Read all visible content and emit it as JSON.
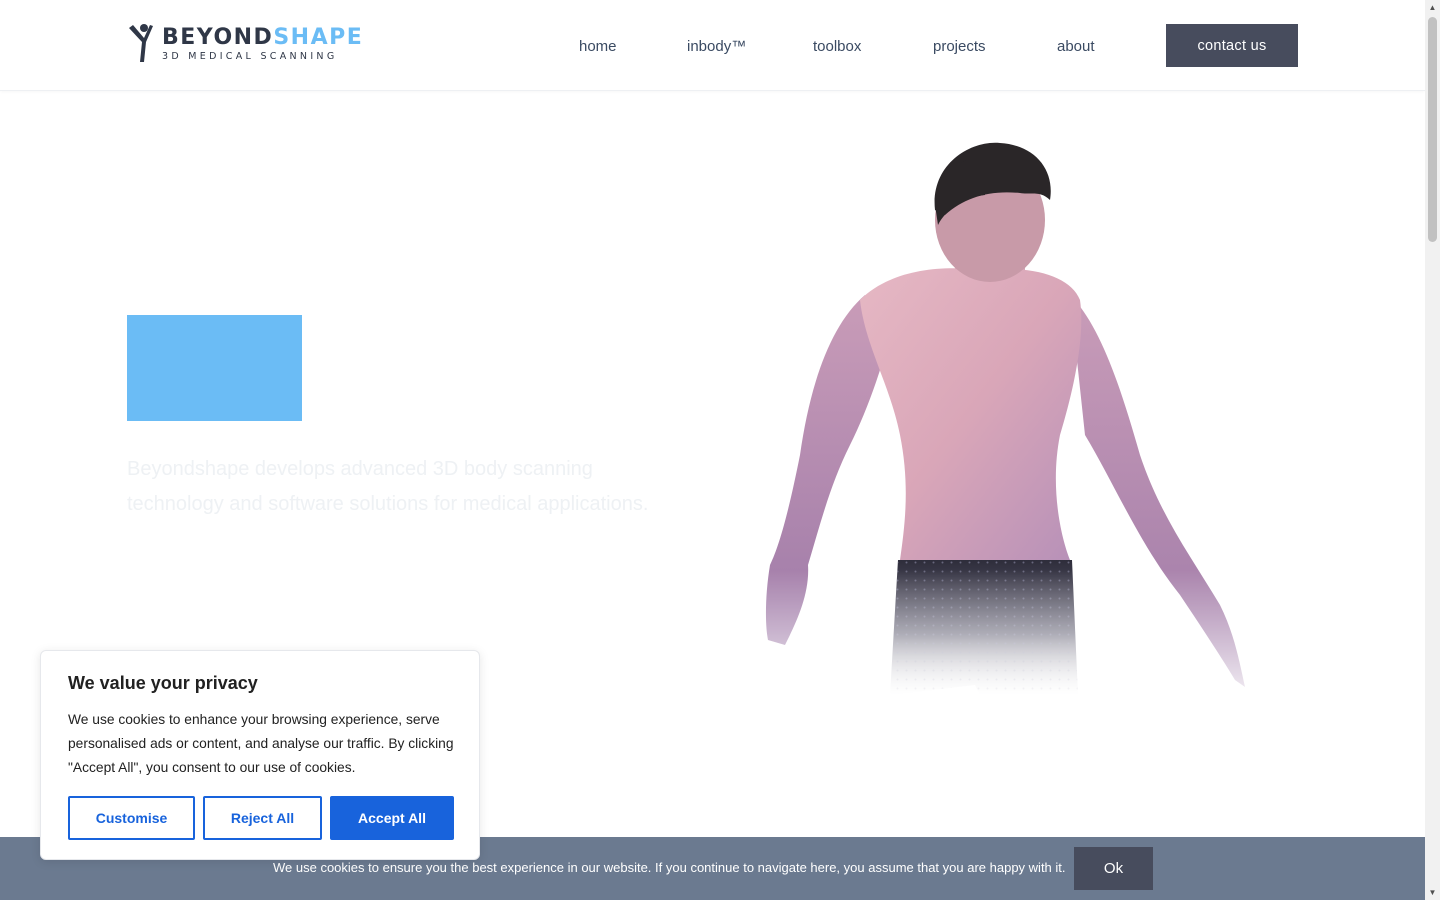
{
  "header": {
    "logo": {
      "word_part1": "BEYOND",
      "word_part2": "SHAPE",
      "subtitle": "3D MEDICAL SCANNING",
      "icon": "figure-logo-icon"
    },
    "nav": [
      {
        "label": "home"
      },
      {
        "label": "inbody™"
      },
      {
        "label": "toolbox"
      },
      {
        "label": "projects"
      },
      {
        "label": "about"
      }
    ],
    "contact_label": "contact us"
  },
  "hero": {
    "text": "Beyondshape develops advanced 3D body scanning technology and software solutions for medical applications.",
    "image": "3d-body-scan-back-view",
    "accent_color": "#6bbcf5"
  },
  "cookie_modal": {
    "title": "We value your privacy",
    "body": "We use cookies to enhance your browsing experience, serve personalised ads or content, and analyse our traffic. By clicking \"Accept All\", you consent to our use of cookies.",
    "buttons": {
      "customise": "Customise",
      "reject": "Reject All",
      "accept": "Accept All"
    },
    "button_color": "#1863dc"
  },
  "notice_bar": {
    "text": "We use cookies to ensure you the best experience in our website. If you continue to navigate here, you assume that you are happy with it.",
    "ok_label": "Ok",
    "color": "#6b7a90"
  },
  "scrollbar": {
    "up_icon": "triangle-up-icon",
    "down_icon": "triangle-down-icon"
  }
}
